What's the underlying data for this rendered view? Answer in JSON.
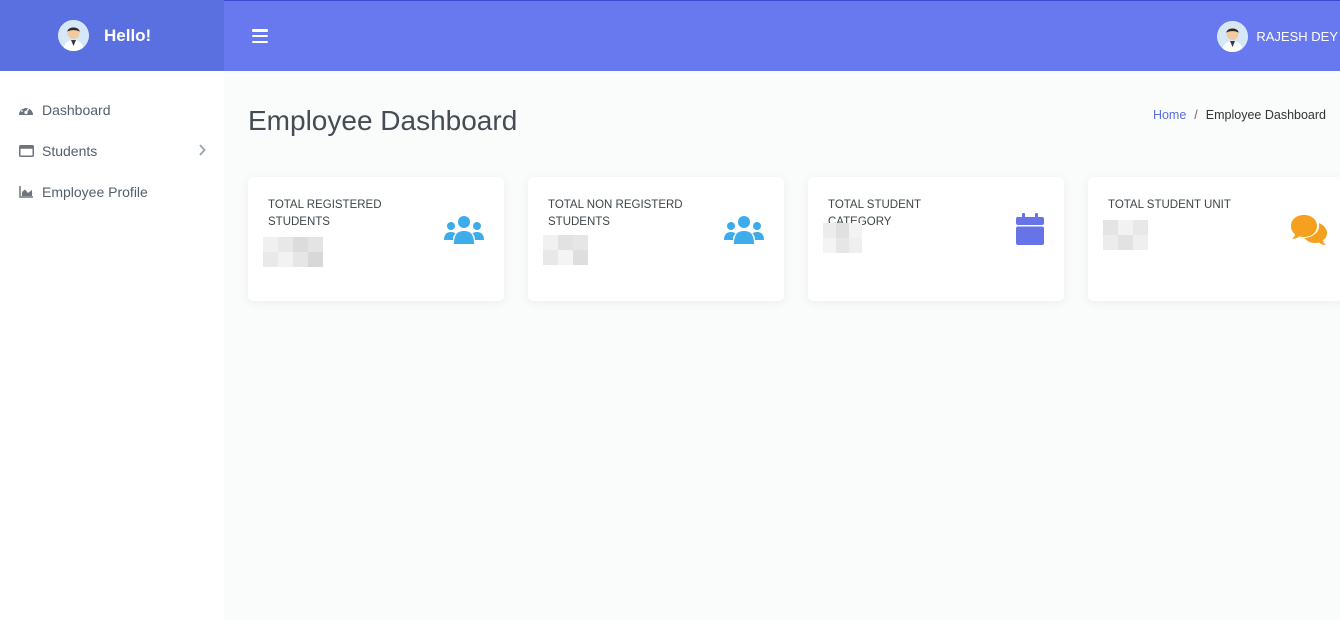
{
  "brand": {
    "text": "Hello!"
  },
  "sidebar": {
    "items": [
      {
        "label": "Dashboard",
        "icon": "dashboard-gauge-icon"
      },
      {
        "label": "Students",
        "icon": "window-icon",
        "has_children": true
      },
      {
        "label": "Employee Profile",
        "icon": "area-chart-icon"
      }
    ]
  },
  "topbar": {
    "menu_icon": "hamburger-icon",
    "user_name": "RAJESH DEY"
  },
  "page": {
    "title": "Employee Dashboard"
  },
  "breadcrumb": {
    "home": "Home",
    "separator": "/",
    "current": "Employee Dashboard"
  },
  "cards": [
    {
      "title": "TOTAL REGISTERED STUDENTS",
      "icon": "users-icon",
      "icon_color": "#3dacea"
    },
    {
      "title": "TOTAL NON REGISTERD STUDENTS",
      "icon": "users-icon",
      "icon_color": "#3dacea"
    },
    {
      "title": "TOTAL STUDENT CATEGORY",
      "icon": "calendar-icon",
      "icon_color": "#6674e8"
    },
    {
      "title": "TOTAL STUDENT UNIT",
      "icon": "comments-icon",
      "icon_color": "#f5a01e"
    }
  ],
  "colors": {
    "brand": "#5a6fe0",
    "topbar": "#6878ee",
    "background": "#fafbfb"
  }
}
